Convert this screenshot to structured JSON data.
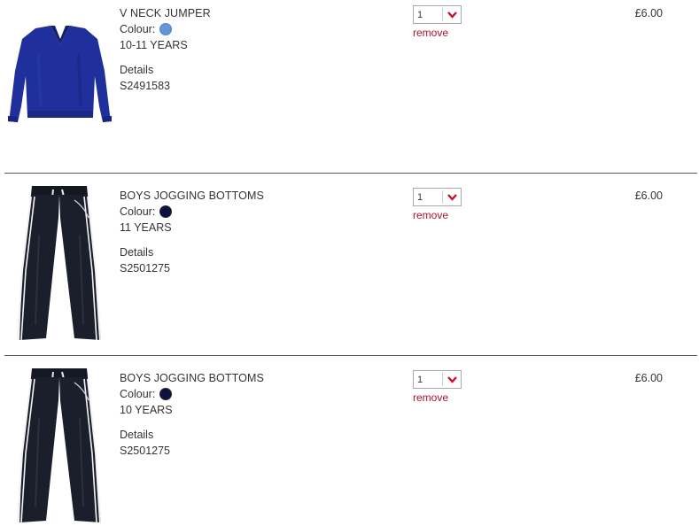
{
  "labels": {
    "colour": "Colour:",
    "details": "Details",
    "remove": "remove"
  },
  "items": [
    {
      "name": "V NECK JUMPER",
      "colour_hex": "#6495d8",
      "size": "10-11 YEARS",
      "code": "S2491583",
      "quantity": "1",
      "price": "£6.00",
      "image_icon": "v-neck-jumper-image"
    },
    {
      "name": "BOYS JOGGING BOTTOMS",
      "colour_hex": "#0b1242",
      "size": "11 YEARS",
      "code": "S2501275",
      "quantity": "1",
      "price": "£6.00",
      "image_icon": "jogging-bottoms-image"
    },
    {
      "name": "BOYS JOGGING BOTTOMS",
      "colour_hex": "#0b1242",
      "size": "10 YEARS",
      "code": "S2501275",
      "quantity": "1",
      "price": "£6.00",
      "image_icon": "jogging-bottoms-image"
    }
  ],
  "colors": {
    "remove_link": "#b01030",
    "dropdown_arrow": "#c8102e",
    "divider": "#555555",
    "text": "#333333"
  }
}
